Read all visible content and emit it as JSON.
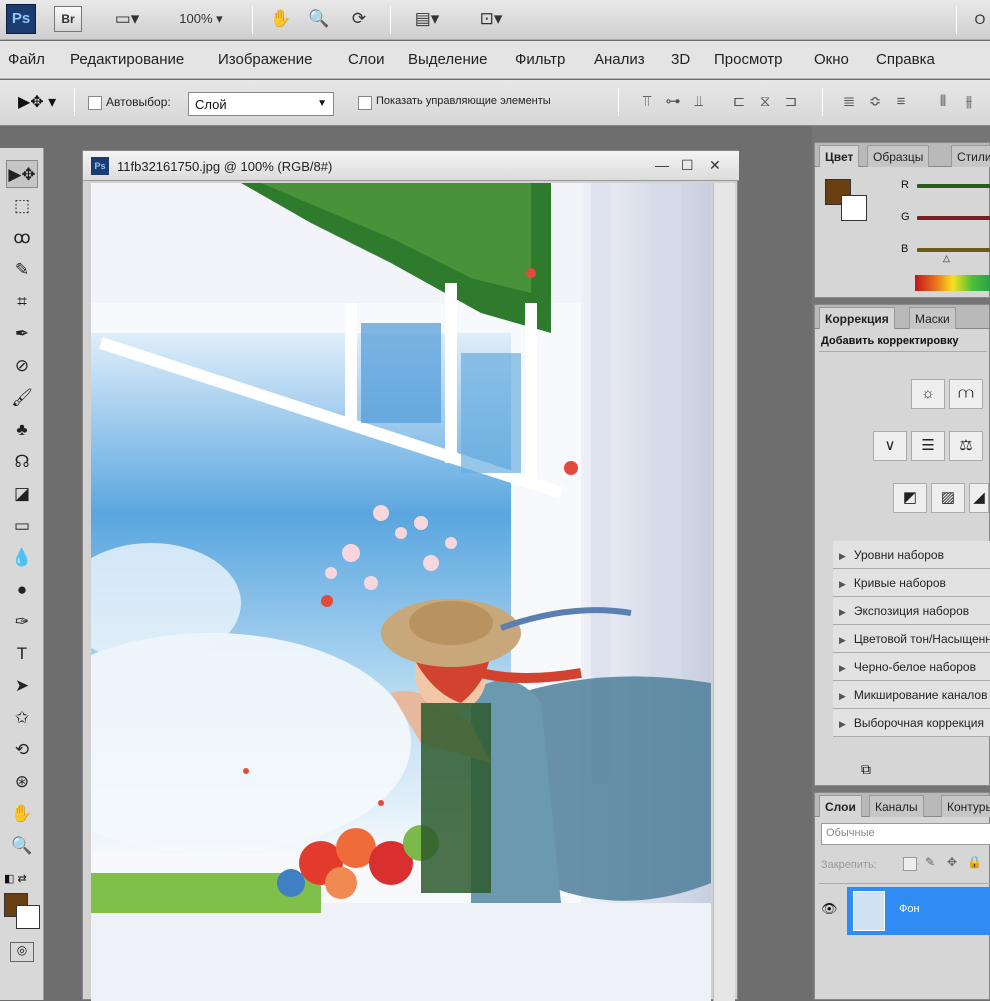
{
  "appbar": {
    "logo": "Ps",
    "bridge": "Br",
    "zoom": "100%",
    "icons": [
      "screen-mode-icon",
      "hand-icon",
      "zoom-icon",
      "rotate-view-icon",
      "arrange-documents-icon",
      "screen-mode-alt-icon"
    ],
    "extra": "О"
  },
  "menu": [
    "Файл",
    "Редактирование",
    "Изображение",
    "Слои",
    "Выделение",
    "Фильтр",
    "Анализ",
    "3D",
    "Просмотр",
    "Окно",
    "Справка"
  ],
  "options": {
    "autoselect_label": "Автовыбор:",
    "autoselect_value": "Слой",
    "show_controls_label": "Показать управляющие элементы"
  },
  "tools": [
    {
      "name": "move-tool-icon",
      "glyph": "▶✥"
    },
    {
      "name": "marquee-tool-icon",
      "glyph": "⬚"
    },
    {
      "name": "lasso-tool-icon",
      "glyph": "ꝏ"
    },
    {
      "name": "quick-select-tool-icon",
      "glyph": "✎"
    },
    {
      "name": "crop-tool-icon",
      "glyph": "⌗"
    },
    {
      "name": "eyedropper-tool-icon",
      "glyph": "✒"
    },
    {
      "name": "healing-brush-tool-icon",
      "glyph": "⊘"
    },
    {
      "name": "brush-tool-icon",
      "glyph": "🖌"
    },
    {
      "name": "clone-stamp-tool-icon",
      "glyph": "♣"
    },
    {
      "name": "history-brush-tool-icon",
      "glyph": "☊"
    },
    {
      "name": "eraser-tool-icon",
      "glyph": "◪"
    },
    {
      "name": "gradient-tool-icon",
      "glyph": "▭"
    },
    {
      "name": "blur-tool-icon",
      "glyph": "💧"
    },
    {
      "name": "dodge-tool-icon",
      "glyph": "●"
    },
    {
      "name": "pen-tool-icon",
      "glyph": "✑"
    },
    {
      "name": "type-tool-icon",
      "glyph": "T"
    },
    {
      "name": "path-select-tool-icon",
      "glyph": "➤"
    },
    {
      "name": "shape-tool-icon",
      "glyph": "✩"
    },
    {
      "name": "3d-rotate-tool-icon",
      "glyph": "⟲"
    },
    {
      "name": "3d-orbit-tool-icon",
      "glyph": "⊛"
    },
    {
      "name": "hand-tool-icon",
      "glyph": "✋"
    },
    {
      "name": "zoom-tool-icon",
      "glyph": "🔍"
    }
  ],
  "colors": {
    "foreground": "#6a4013",
    "background": "#ffffff"
  },
  "document": {
    "title": "11fb32161750.jpg @ 100% (RGB/8#)",
    "minimize": "—",
    "maximize": "☐",
    "close": "✕"
  },
  "color_panel": {
    "tabs": [
      "Цвет",
      "Образцы",
      "Стили"
    ],
    "r_label": "R",
    "g_label": "G",
    "b_label": "B"
  },
  "adjust_panel": {
    "tabs": [
      "Коррекция",
      "Маски"
    ],
    "heading": "Добавить корректировку",
    "presets": [
      "Уровни наборов",
      "Кривые наборов",
      "Экспозиция наборов",
      "Цветовой тон/Насыщенность",
      "Черно-белое наборов",
      "Микширование каналов",
      "Выборочная коррекция"
    ]
  },
  "layers_panel": {
    "tabs": [
      "Слои",
      "Каналы",
      "Контуры"
    ],
    "blend_mode": "Обычные",
    "lock_label": "Закрепить:",
    "layer_name": "Фон"
  }
}
